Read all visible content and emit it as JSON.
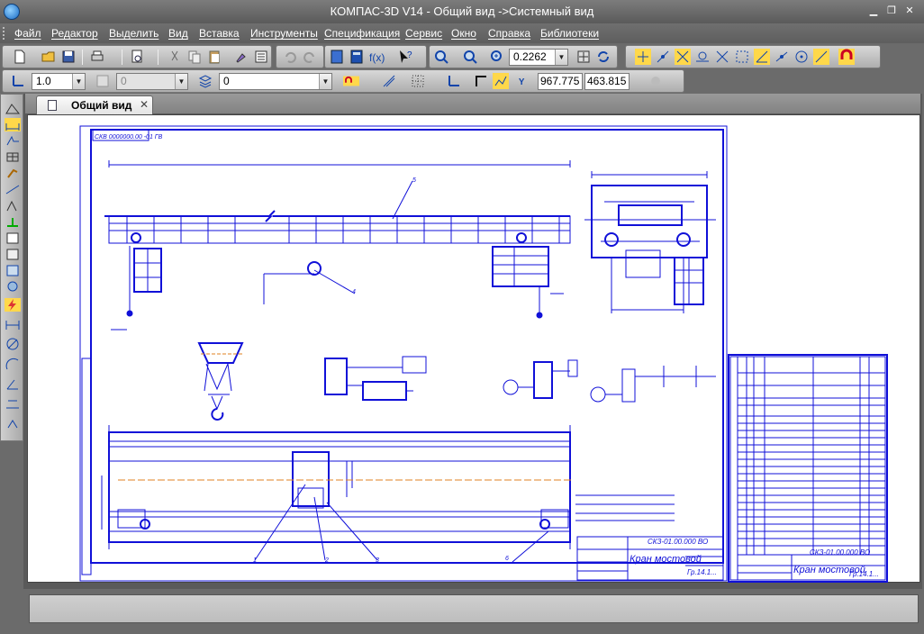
{
  "window": {
    "title": "КОМПАС-3D V14 - Общий вид ->Системный вид"
  },
  "menu": [
    "Файл",
    "Редактор",
    "Выделить",
    "Вид",
    "Вставка",
    "Инструменты",
    "Спецификация",
    "Сервис",
    "Окно",
    "Справка",
    "Библиотеки"
  ],
  "toolbar": {
    "zoom_value": "0.2262",
    "line_scale_value": "1.0",
    "step_value": "0",
    "layer_value": "0",
    "coord_x": "967.775",
    "coord_y": "463.815"
  },
  "document_tab": {
    "label": "Общий вид",
    "close": "✕"
  },
  "drawing": {
    "main_title": "Кран мостовой",
    "code_main": "СКЗ-01.00.000 ВО",
    "code_spec": "СКЗ-01.00.000 ВО",
    "spec_title": "Кран мостовой",
    "footnote": "Гр.14.1...",
    "stamp": "СКВ 0000000.00 -01 ГВ",
    "callouts": [
      "1",
      "2",
      "3",
      "4",
      "5",
      "6"
    ]
  },
  "colors": {
    "drawing_line": "#1010d8",
    "accent_center": "#e08020",
    "chrome": "#6b6b6b"
  }
}
